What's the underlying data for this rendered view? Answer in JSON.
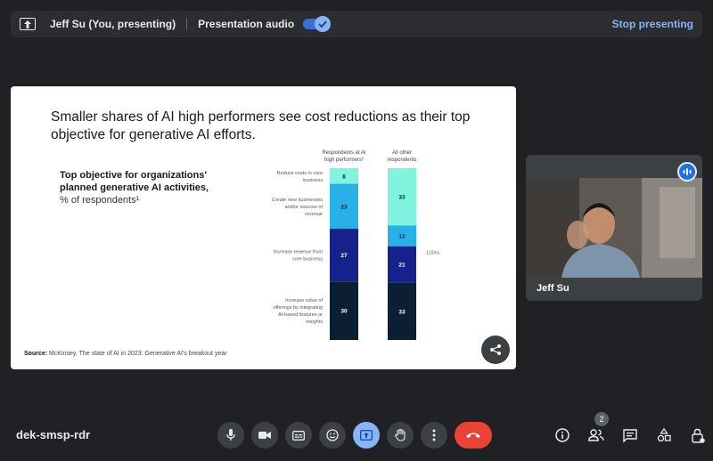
{
  "topbar": {
    "presenter": "Jeff Su (You, presenting)",
    "audio_label": "Presentation audio",
    "stop_label": "Stop presenting",
    "audio_on": true
  },
  "slide": {
    "title": "Smaller shares of AI high performers see cost reductions as their top objective for generative AI efforts.",
    "subtitle": "Top objective for organizations' planned generative AI activities,",
    "unit": "% of respondents¹",
    "source_label": "Source:",
    "source_text": "McKinsey, The state of AI in 2023: Generative AI's breakout year"
  },
  "chart_data": {
    "type": "bar",
    "stacked": true,
    "title": "Top objective for organizations' planned generative AI activities, % of respondents¹",
    "categories": [
      "Respondents at AI high performers²",
      "All other respondents"
    ],
    "total_label": "100%",
    "series": [
      {
        "name": "Reduce costs in core business",
        "values": [
          8,
          33
        ],
        "value_labels": [
          "8",
          "33"
        ],
        "color": "#7ff5e0"
      },
      {
        "name": "Create new businesses and/or sources of revenue",
        "values": [
          23,
          12
        ],
        "value_labels": [
          "23",
          "12"
        ],
        "color": "#29b0e8"
      },
      {
        "name": "Increase revenue from core business",
        "values": [
          27,
          21
        ],
        "value_labels": [
          "27",
          "21"
        ],
        "color": "#16228c"
      },
      {
        "name": "Increase value of offerings by integrating AI-based features or insights",
        "values": [
          30,
          33
        ],
        "value_labels": [
          "30",
          "33"
        ],
        "color": "#0b1f33"
      }
    ]
  },
  "self_view": {
    "name": "Jeff Su"
  },
  "bottom": {
    "meeting_code": "dek-smsp-rdr",
    "participants_count": "2"
  },
  "icons": {
    "present": "present-to-all-icon",
    "mic": "mic-icon",
    "camera": "videocam-icon",
    "captions": "closed-caption-icon",
    "emoji": "emoji-icon",
    "present_now": "present-now-icon",
    "hand": "raise-hand-icon",
    "more": "more-vert-icon",
    "end": "call-end-icon",
    "info": "info-icon",
    "people": "people-icon",
    "chat": "chat-icon",
    "activities": "activities-icon",
    "lock": "host-controls-icon",
    "share": "share-icon",
    "speaking": "speaking-indicator-icon"
  }
}
